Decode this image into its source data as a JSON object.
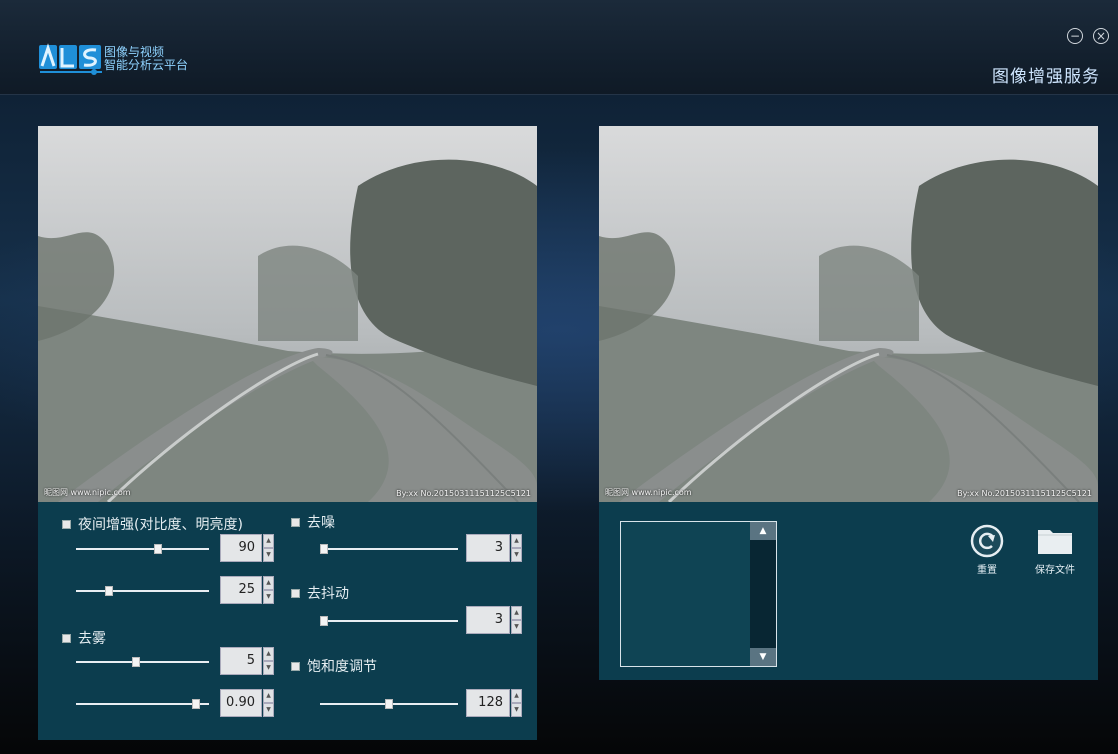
{
  "app": {
    "logo_line1": "图像与视频",
    "logo_line2": "智能分析云平台",
    "service_title": "图像增强服务",
    "minimize_glyph": "−",
    "close_glyph": "×"
  },
  "source_image": {
    "watermark_left": "昵图网 www.nipic.com",
    "watermark_right": "By:xx No.20150311151125C5121"
  },
  "result_image": {
    "watermark_left": "昵图网 www.nipic.com",
    "watermark_right": "By:xx No.20150311151125C5121"
  },
  "controls": {
    "night_enhance": {
      "label": "夜间增强(对比度、明亮度)",
      "contrast": "90",
      "brightness": "25",
      "contrast_level": 0.62,
      "brightness_level": 0.25
    },
    "denoise": {
      "label": "去噪",
      "value": "3",
      "level": 0.03
    },
    "deshake": {
      "label": "去抖动",
      "value": "3",
      "level": 0.03
    },
    "defog": {
      "label": "去雾",
      "strength": "5",
      "ratio": "0.90",
      "strength_level": 0.45,
      "ratio_level": 0.9
    },
    "saturation": {
      "label": "饱和度调节",
      "value": "128",
      "level": 0.5
    }
  },
  "actions": {
    "reset_label": "重置",
    "save_label": "保存文件"
  },
  "icons": {
    "reset": "reset-icon",
    "save": "folder-icon",
    "minimize": "minimize-icon",
    "close": "close-icon"
  },
  "colors": {
    "panel": "#0c3d4e",
    "accent": "#8fd3ff"
  }
}
